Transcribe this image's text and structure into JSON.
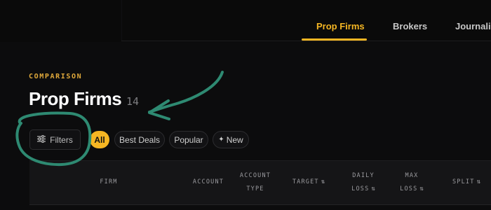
{
  "nav": {
    "tabs": [
      {
        "label": "Prop Firms",
        "active": true
      },
      {
        "label": "Brokers",
        "active": false
      },
      {
        "label": "Journaling",
        "active": false
      }
    ]
  },
  "header": {
    "eyebrow": "COMPARISON",
    "title": "Prop Firms",
    "count": "14"
  },
  "filters": {
    "button_label": "Filters",
    "chips": [
      {
        "label": "All",
        "active": true
      },
      {
        "label": "Best Deals",
        "active": false
      },
      {
        "label": "Popular",
        "active": false
      },
      {
        "label": "New",
        "active": false,
        "icon": "sparkle-icon"
      }
    ]
  },
  "table": {
    "columns": [
      {
        "label": "FIRM"
      },
      {
        "label": "ACCOUNT"
      },
      {
        "label": "ACCOUNT TYPE"
      },
      {
        "label": "TARGET",
        "sort": "⇅"
      },
      {
        "label": "DAILY LOSS",
        "sort": "⇅"
      },
      {
        "label": "MAX LOSS",
        "sort": "⇅"
      },
      {
        "label": "SPLIT",
        "sort": "⇅"
      }
    ]
  },
  "colors": {
    "accent": "#f5b623",
    "background": "#0c0c0d",
    "annotation": "#2e8a72"
  }
}
